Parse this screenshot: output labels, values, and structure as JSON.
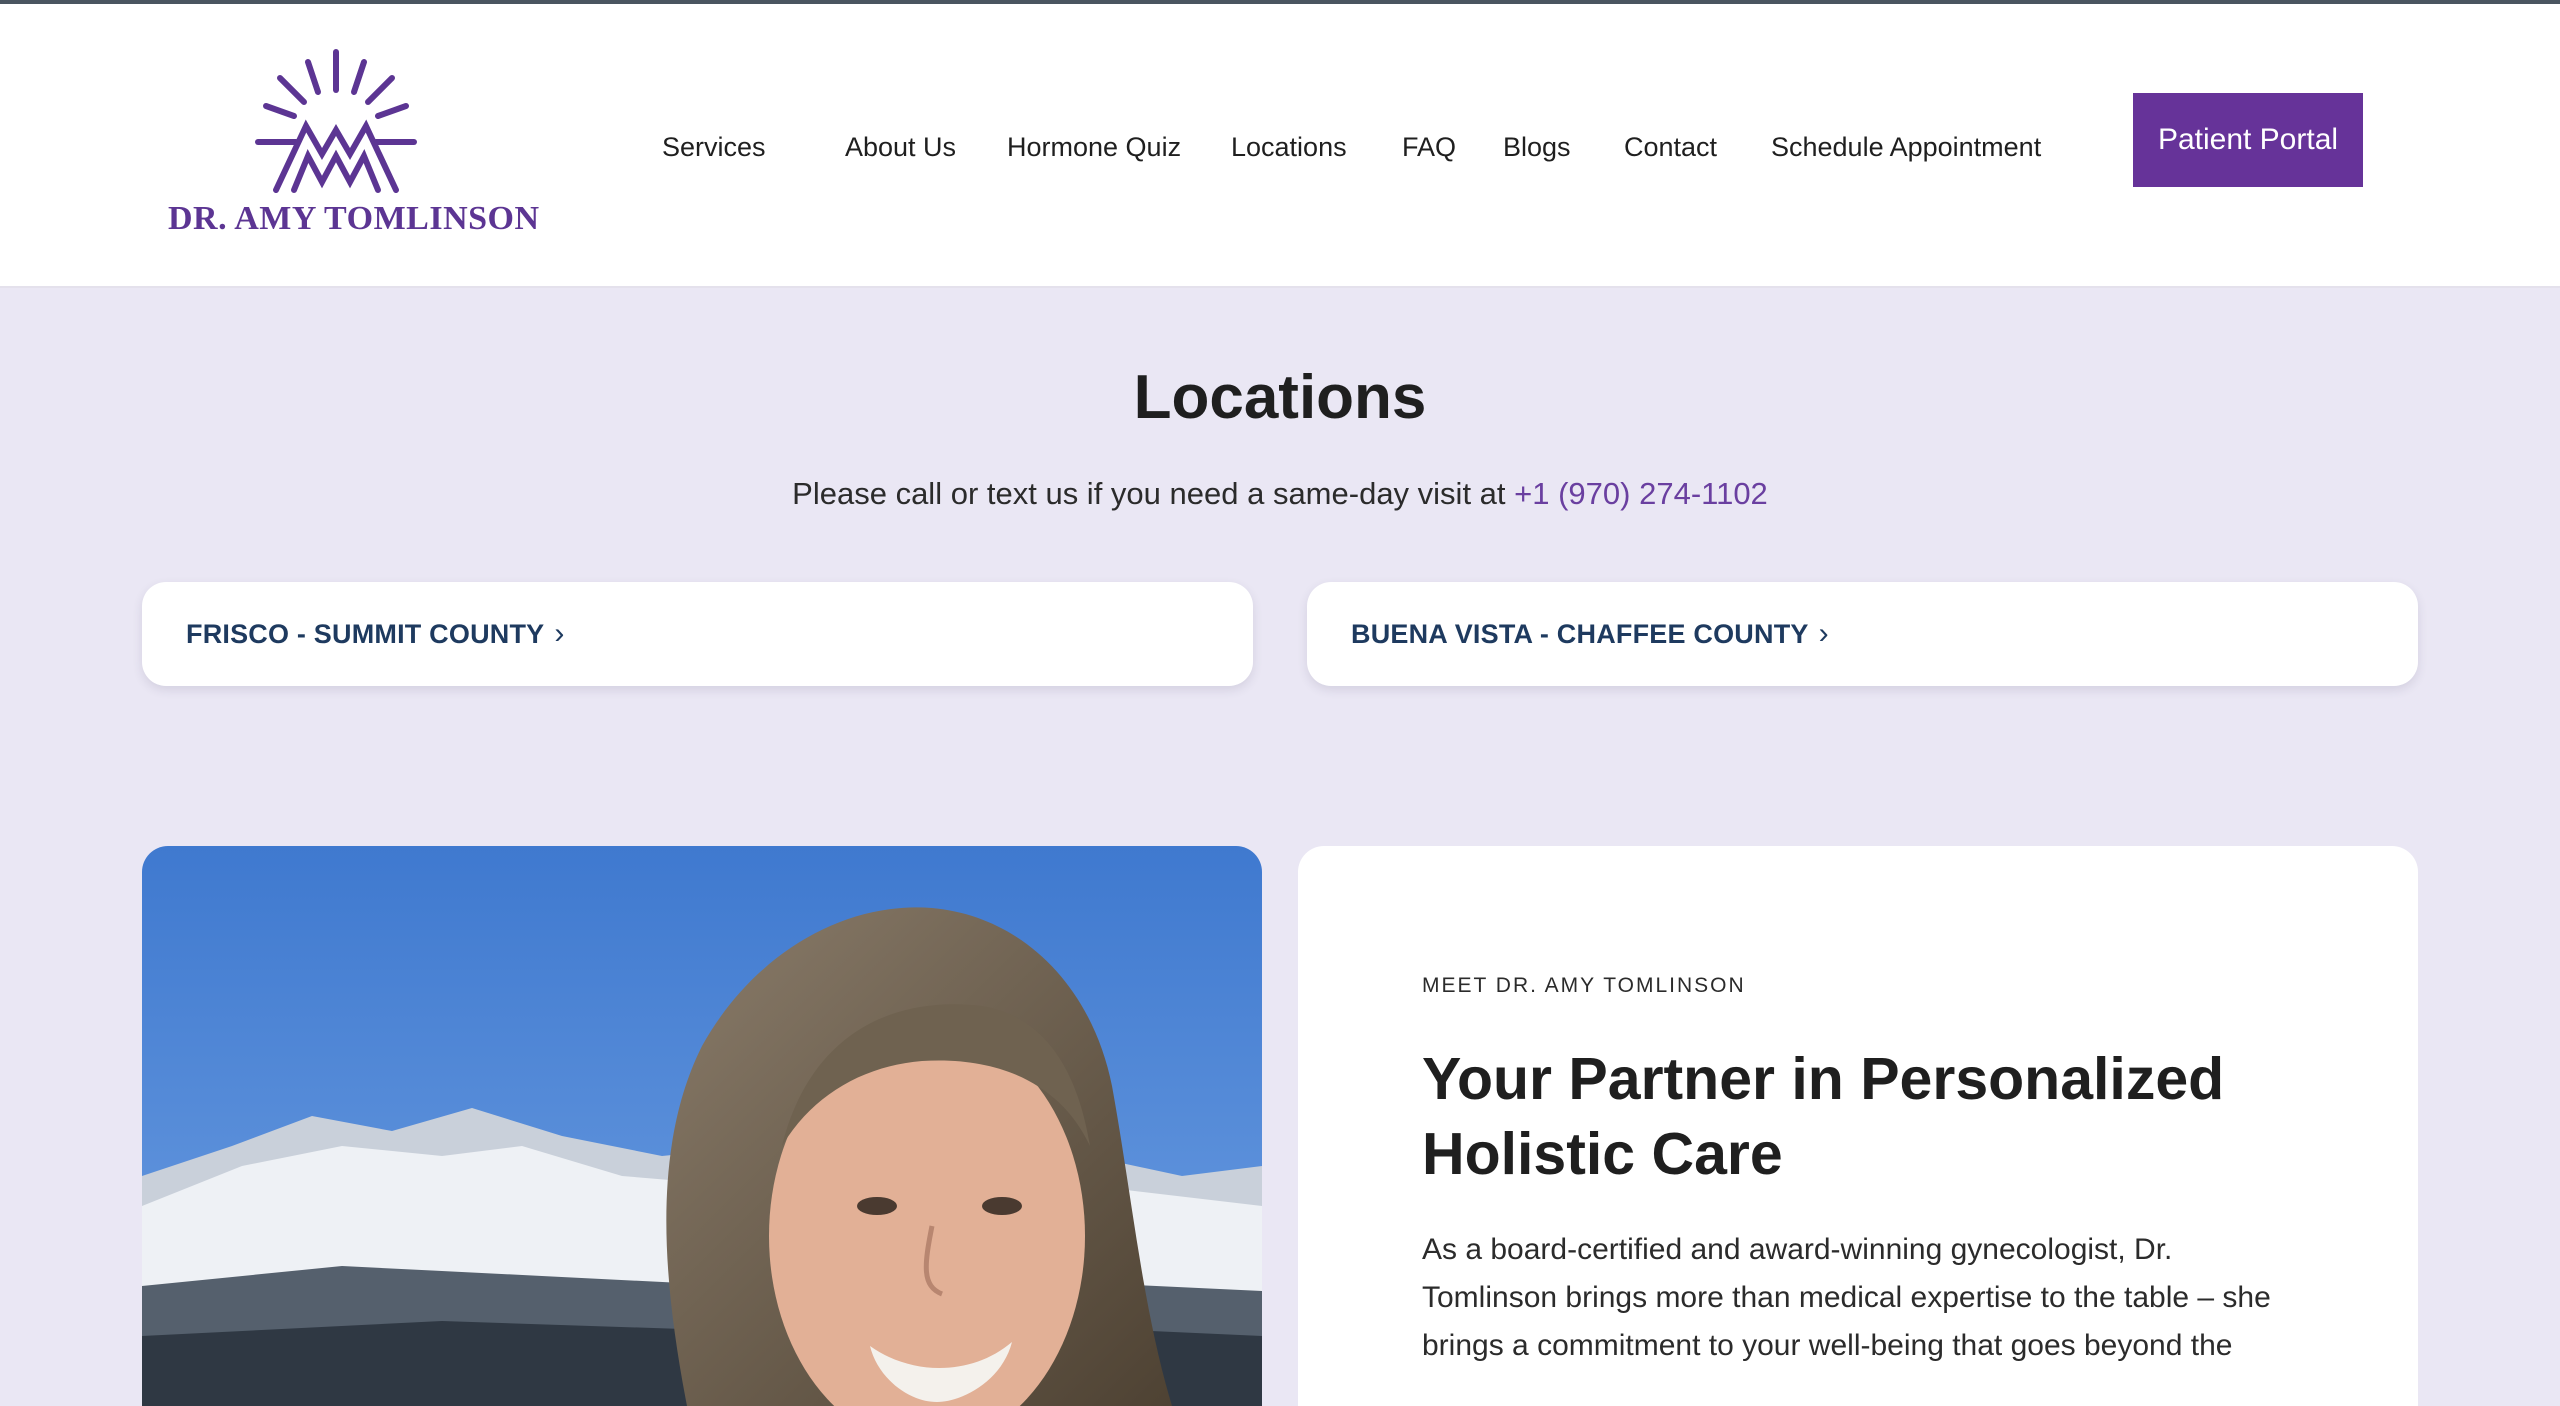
{
  "logo": {
    "text": "DR. AMY TOMLINSON"
  },
  "nav": {
    "items": [
      "Services",
      "About Us",
      "Hormone Quiz",
      "Locations",
      "FAQ",
      "Blogs",
      "Contact",
      "Schedule Appointment"
    ],
    "portal_label": "Patient Portal"
  },
  "locations": {
    "title": "Locations",
    "subtitle": "Please call or text us if you need a same-day visit at",
    "phone": "+1 (970) 274-1102",
    "cards": [
      "FRISCO - SUMMIT COUNTY",
      "BUENA VISTA - CHAFFEE COUNTY"
    ],
    "chevron": "›"
  },
  "about": {
    "eyebrow": "MEET DR. AMY TOMLINSON",
    "title": "Your Partner in Personalized Holistic Care",
    "body": "As a board-certified and award-winning gynecologist, Dr. Tomlinson brings more than medical expertise to the table – she brings a commitment to your well-being that goes beyond the"
  },
  "colors": {
    "brand_purple": "#663399",
    "link_purple": "#6a3fa0",
    "page_bg": "#eae7f4",
    "card_text": "#1e3a5f"
  }
}
